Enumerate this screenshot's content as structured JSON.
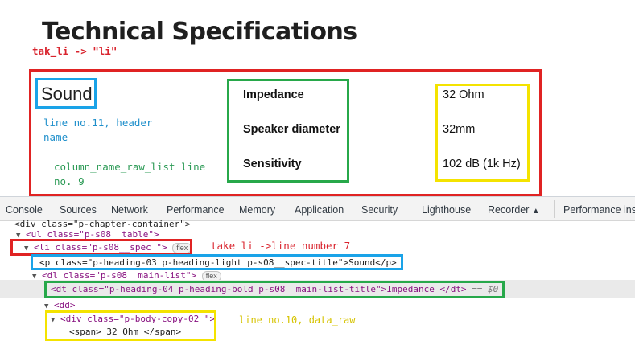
{
  "page": {
    "title": "Technical Specifications"
  },
  "annotations": {
    "red_top": "tak_li -> \"li\"",
    "cyan": "line no.11, header name",
    "green_left": "column_name_raw_list line no. 9",
    "red_bottom": "take li ->line number 7",
    "yellow": "line no.10, data_raw"
  },
  "spec": {
    "header": "Sound",
    "rows": [
      {
        "label": "Impedance",
        "value": "32 Ohm"
      },
      {
        "label": "Speaker diameter",
        "value": "32mm"
      },
      {
        "label": "Sensitivity",
        "value": "102 dB (1k Hz)"
      }
    ]
  },
  "devtools": {
    "tabs": [
      "Console",
      "Sources",
      "Network",
      "Performance",
      "Memory",
      "Application",
      "Security",
      "Lighthouse",
      "Recorder",
      "Performance insi"
    ],
    "recorder_icon": "flask-icon",
    "lines": {
      "l0": "<div class=\"p-chapter-container\">",
      "l1": "<ul class=\"p-s08__table\">",
      "l2": "<li class=\"p-s08__spec \">",
      "l2_pill": "flex",
      "l3": "<p class=\"p-heading-03 p-heading-light p-s08__spec-title\">Sound</p>",
      "l4": "<dl class=\"p-s08__main-list\">",
      "l4_pill": "flex",
      "l5": "<dt class=\"p-heading-04 p-heading-bold p-s08__main-list-title\">Impedance </dt>",
      "l5_eq": "== $0",
      "l6": "<dd>",
      "l7": "<div class=\"p-body-copy-02 \">",
      "l8": "<span> 32 Ohm </span>"
    }
  },
  "colors": {
    "red": "#e02323",
    "blue": "#1aa3e8",
    "green": "#27a84a",
    "yellow": "#f4e300"
  }
}
